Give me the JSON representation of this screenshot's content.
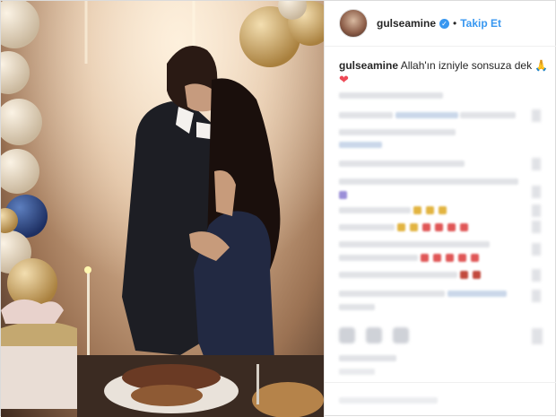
{
  "post": {
    "username": "gulseamine",
    "follow_label": "Takip Et",
    "separator": "•",
    "verified_glyph": "✓",
    "caption_text": "Allah'ın izniyle sonsuza dek",
    "caption_emoji": "🙏",
    "heart_emoji": "❤"
  }
}
